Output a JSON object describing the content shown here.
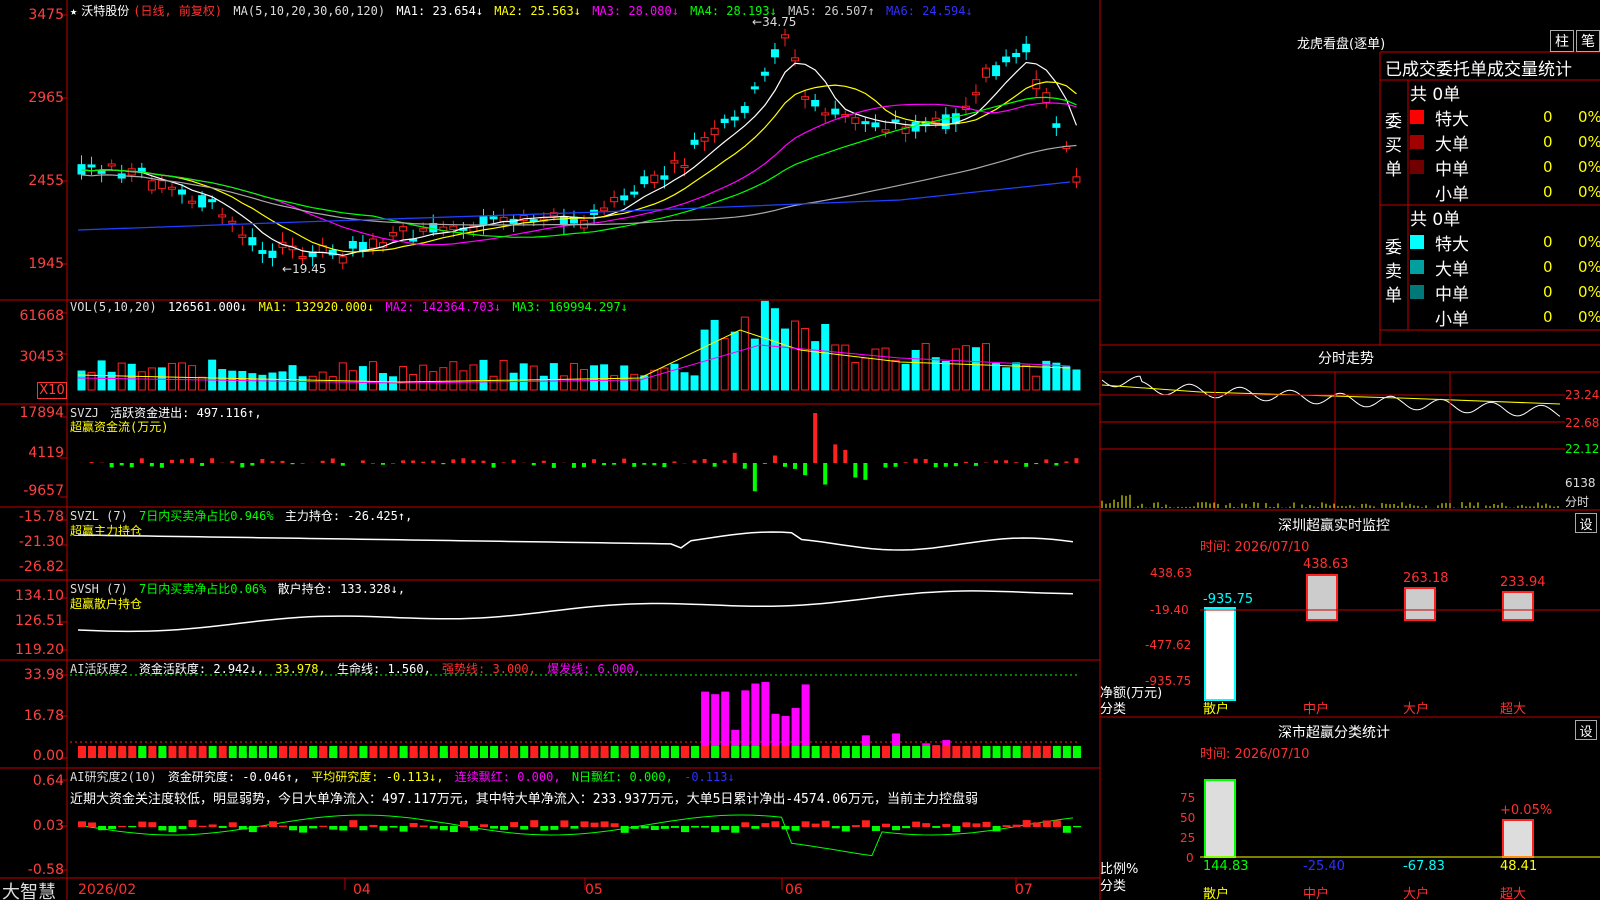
{
  "stock": {
    "star": "★",
    "name": "沃特股份",
    "mode": "(日线, 前复权)"
  },
  "ma_header": {
    "label": "MA(5,10,20,30,60,120)",
    "ma1": "MA1: 23.654↓",
    "ma2": "MA2: 25.563↓",
    "ma3": "MA3: 28.080↓",
    "ma4": "MA4: 28.193↓",
    "ma5": "MA5: 26.507↑",
    "ma6": "MA6: 24.594↓"
  },
  "price_axis": [
    "3475",
    "2965",
    "2455",
    "1945"
  ],
  "price_annotations": {
    "high": "34.75",
    "low": "19.45"
  },
  "vol_header": {
    "label": "VOL(5,10,20)",
    "v": "126561.000↓",
    "ma1": "MA1: 132920.000↓",
    "ma2": "MA2: 142364.703↓",
    "ma3": "MA3: 169994.297↓"
  },
  "vol_axis": [
    "61668",
    "30453",
    "X10"
  ],
  "svzj": {
    "label": "SVZJ",
    "text": "活跃资金进出: 497.116↑,",
    "sub": "超赢资金流(万元)",
    "axis": [
      "17894",
      "4119",
      "-9657"
    ]
  },
  "svzl": {
    "label": "SVZL (7)",
    "text1": "7日内买卖净占比0.946%",
    "text2": "主力持仓: -26.425↑,",
    "sub": "超赢主力持仓",
    "axis": [
      "-15.78",
      "-21.30",
      "-26.82"
    ]
  },
  "svsh": {
    "label": "SVSH (7)",
    "text1": "7日内买卖净占比0.06%",
    "text2": "散户持仓: 133.328↓,",
    "sub": "超赢散户持仓",
    "axis": [
      "134.10",
      "126.51",
      "119.20"
    ]
  },
  "ai_active": {
    "label": "AI活跃度2",
    "t1": "资金活跃度: 2.942↓,",
    "t2": "33.978,",
    "t3": "生命线: 1.560,",
    "t4": "强势线: 3.000,",
    "t5": "爆发线: 6.000,",
    "axis": [
      "33.98",
      "16.78",
      "0.00"
    ]
  },
  "ai_research": {
    "label": "AI研究度2(10)",
    "t1": "资金研究度: -0.046↑,",
    "t2": "平均研究度: -0.113↓,",
    "t3": "连续飘红: 0.000,",
    "t4": "N日飘红: 0.000,",
    "t5": "-0.113↓",
    "note": "近期大资金关注度较低，明显弱势，今日大单净流入：497.117万元，其中特大单净流入：233.937万元，大单5日累计净出-4574.06万元，当前主力控盘弱",
    "axis": [
      "0.64",
      "0.03",
      "-0.58"
    ]
  },
  "date_axis": [
    "2026/02",
    "04",
    "05",
    "06",
    "07"
  ],
  "brand": "大智慧",
  "right": {
    "lhb_title": "龙虎看盘(逐单)",
    "btn_zhu": "柱",
    "btn_bi": "笔",
    "tabs": [
      "已成交委托单成交量统计"
    ],
    "buy": {
      "label": "委买单",
      "total": "共 0单",
      "rows": [
        {
          "name": "特大",
          "v": "0",
          "p": "0%",
          "color": "#ff0000"
        },
        {
          "name": "大单",
          "v": "0",
          "p": "0%",
          "color": "#a00000"
        },
        {
          "name": "中单",
          "v": "0",
          "p": "0%",
          "color": "#700000"
        },
        {
          "name": "小单",
          "v": "0",
          "p": "0%",
          "color": ""
        }
      ]
    },
    "sell": {
      "label": "委卖单",
      "total": "共 0单",
      "rows": [
        {
          "name": "特大",
          "v": "0",
          "p": "0%",
          "color": "#00ffff"
        },
        {
          "name": "大单",
          "v": "0",
          "p": "0%",
          "color": "#00a0a0"
        },
        {
          "name": "中单",
          "v": "0",
          "p": "0%",
          "color": "#007878"
        },
        {
          "name": "小单",
          "v": "0",
          "p": "0%",
          "color": ""
        }
      ]
    },
    "intraday_title": "分时走势",
    "intraday_axis": [
      "23.24",
      "22.68",
      "22.12",
      "6138",
      "分时"
    ],
    "monitor_title": "深圳超赢实时监控",
    "monitor_btn": "设",
    "monitor_time": "时间: 2026/07/10",
    "monitor_axis": [
      "438.63",
      "-19.40",
      "-477.62",
      "-935.75"
    ],
    "monitor_vals": [
      "-935.75",
      "438.63",
      "263.18",
      "233.94"
    ],
    "monitor_unit": "净额(万元)",
    "monitor_cat": "分类",
    "cats": [
      "散户",
      "中户",
      "大户",
      "超大"
    ],
    "class_title": "深市超赢分类统计",
    "class_btn": "设",
    "class_time": "时间: 2026/07/10",
    "class_axis": [
      "75",
      "50",
      "25",
      "0"
    ],
    "class_top": "+0.05%",
    "class_unit": "比例%",
    "class_cat": "分类",
    "class_vals": [
      "144.83",
      "-25.40",
      "-67.83",
      "48.41"
    ]
  }
}
